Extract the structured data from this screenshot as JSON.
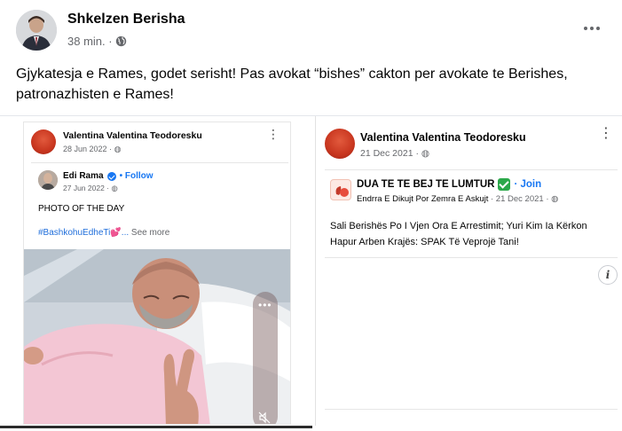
{
  "post": {
    "author": "Shkelzen Berisha",
    "time": "38 min. ·",
    "caption": "Gjykatesja e Rames, godet serisht! Pas avokat “bishes” cakton per avokate te Berishes, patronazhisten e Rames!"
  },
  "left_screenshot": {
    "author": "Valentina Valentina Teodoresku",
    "date": "28 Jun 2022 ·",
    "shared": {
      "author": "Edi Rama",
      "follow": "• Follow",
      "date": "27 Jun 2022 ·",
      "text": "PHOTO OF THE DAY",
      "tags": "#BashkohuEdheTi💕...",
      "see_more": "See more"
    }
  },
  "right_screenshot": {
    "author": "Valentina Valentina Teodoresku",
    "date": "21 Dec 2021 ·",
    "group": {
      "name": "DUA TE TE BEJ TE LUMTUR",
      "join": "· Join",
      "meta_author": "Endrra E Dikujt Por Zemra E Askujt",
      "meta_date": "· 21 Dec 2021 ·",
      "text": "Sali Berishës Po I Vjen Ora E Arrestimit; Yuri Kim Ia Kërkon Hapur Arben Krajës: SPAK Të Veprojë Tani!"
    },
    "info_glyph": "i"
  },
  "icons": [
    "globe-icon",
    "more-options-icon",
    "verified-icon",
    "mute-icon",
    "info-icon"
  ],
  "colors": {
    "link_blue": "#1877f2",
    "meta_grey": "#65676b",
    "check_green": "#2ba84a"
  }
}
